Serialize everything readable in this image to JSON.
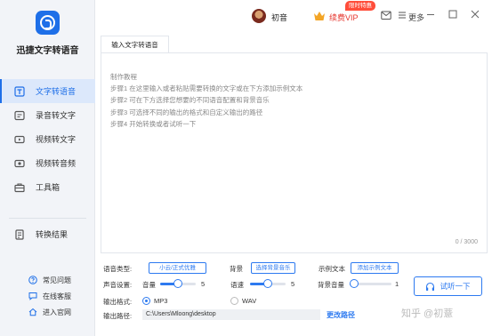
{
  "app": {
    "title": "迅捷文字转语音"
  },
  "sidebar": {
    "items": [
      {
        "label": "文字转语音",
        "icon": "text-to-speech-icon",
        "active": true
      },
      {
        "label": "录音转文字",
        "icon": "recording-icon",
        "active": false
      },
      {
        "label": "视频转文字",
        "icon": "video-icon",
        "active": false
      },
      {
        "label": "视频转音频",
        "icon": "video-audio-icon",
        "active": false
      },
      {
        "label": "工具箱",
        "icon": "toolbox-icon",
        "active": false
      }
    ],
    "result_label": "转换结果",
    "links": [
      {
        "label": "常见问题",
        "icon": "question-icon"
      },
      {
        "label": "在线客服",
        "icon": "chat-icon"
      },
      {
        "label": "进入官网",
        "icon": "home-icon"
      }
    ]
  },
  "topbar": {
    "username": "初音",
    "vip_label": "续费VIP",
    "vip_badge": "限时特惠",
    "more_label": "更多"
  },
  "tab": {
    "label": "输入文字转语音"
  },
  "editor": {
    "instructions": [
      "制作教程",
      "步骤1   在这里输入或者粘贴需要转换的文字或在下方添加示例文本",
      "步骤2   可在下方选择您想要的不同语音配置和背景音乐",
      "步骤3   可选择不同的输出的格式和自定义输出的路径",
      "步骤4   开始转换或者试听一下"
    ],
    "counter": "0 / 3000"
  },
  "settings": {
    "voice_type_label": "语音类型:",
    "voice_type_value": "小云/正式优雅",
    "bgm_label": "背景",
    "bgm_button": "选择背景音乐",
    "sample_label": "示例文本",
    "sample_button": "添加示例文本",
    "sound_settings_label": "声音设置:",
    "volume_label": "音量",
    "volume_value": "5",
    "volume_level": 0.5,
    "speed_label": "语速",
    "speed_value": "5",
    "speed_level": 0.5,
    "bg_volume_label": "背景音量",
    "bg_volume_value": "1",
    "bg_volume_level": 0.1,
    "try_button": "试听一下",
    "format_label": "输出格式:",
    "format_options": [
      "MP3",
      "WAV"
    ],
    "format_selected": "MP3",
    "path_label": "输出路径:",
    "path_value": "C:\\Users\\Mloong\\desktop",
    "change_path": "更改路径"
  },
  "watermark": "知乎 @初薏",
  "colors": {
    "accent": "#2d7af0",
    "vip": "#e6362e",
    "badge": "#ff4d3a"
  }
}
